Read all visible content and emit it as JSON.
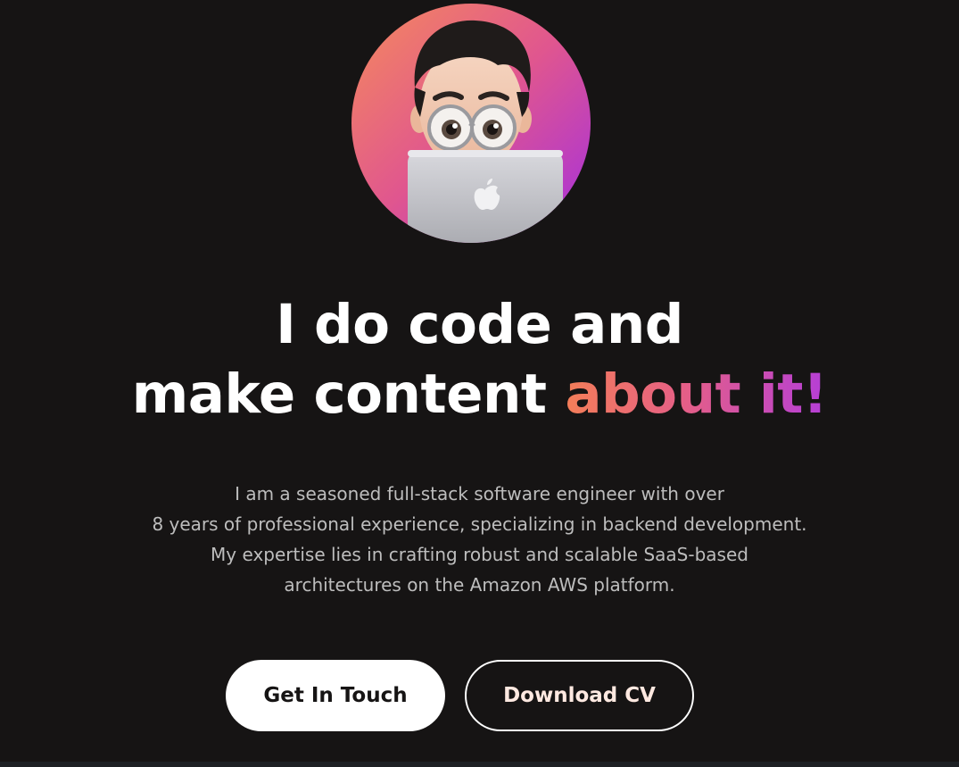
{
  "hero": {
    "avatar_alt": "memoji avatar with laptop",
    "headline": {
      "line1": "I do code and",
      "line2_plain": "make content",
      "line2_highlight": "about it!"
    },
    "bio": [
      "I am a seasoned full-stack software engineer with over",
      "8 years of professional experience, specializing in backend development.",
      "My expertise lies in crafting robust and scalable SaaS-based",
      "architectures on the Amazon AWS platform."
    ],
    "buttons": {
      "primary_label": "Get In Touch",
      "secondary_label": "Download CV"
    }
  },
  "colors": {
    "background": "#161414",
    "gradient_start": "#f47e58",
    "gradient_end": "#b53ed8",
    "text_primary": "#ffffff",
    "text_muted": "#bdbdbd"
  }
}
